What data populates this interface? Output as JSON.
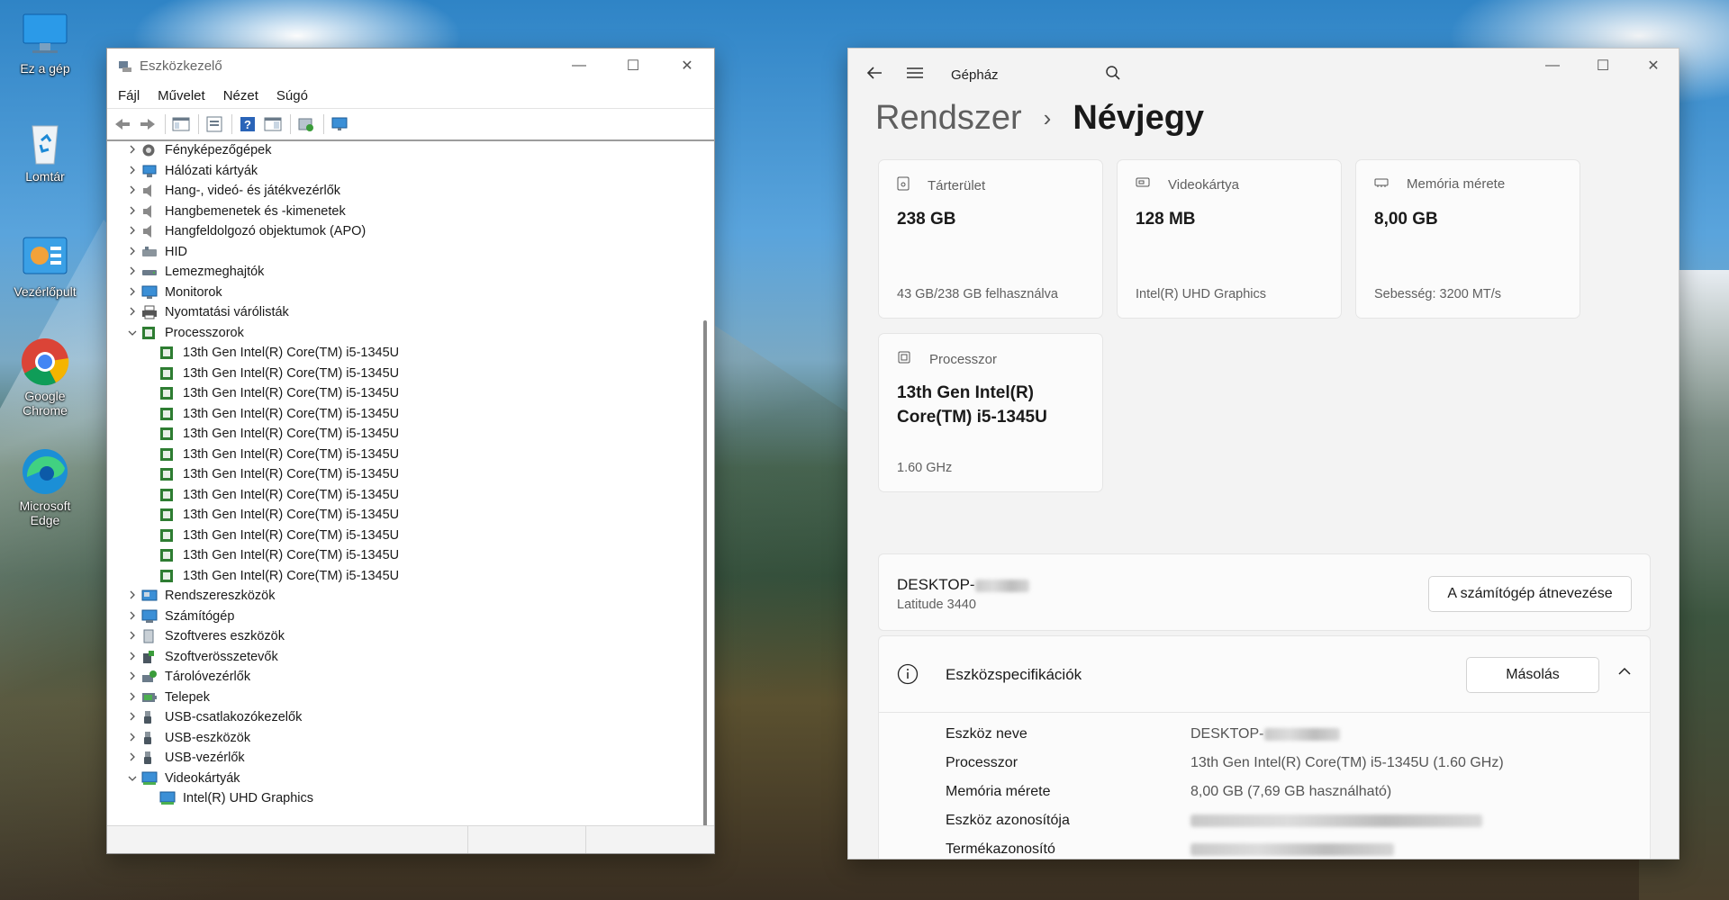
{
  "desktop": {
    "icons": [
      {
        "label": "Ez a gép"
      },
      {
        "label": "Lomtár"
      },
      {
        "label": "Vezérlőpult"
      },
      {
        "label": "Google Chrome"
      },
      {
        "label": "Microsoft Edge"
      }
    ]
  },
  "device_manager": {
    "title": "Eszközkezelő",
    "menu": [
      "Fájl",
      "Művelet",
      "Nézet",
      "Súgó"
    ],
    "tree": [
      {
        "label": "Fényképezőgépek",
        "level": 0,
        "state": "collapsed",
        "icon": "camera-icon"
      },
      {
        "label": "Hálózati kártyák",
        "level": 0,
        "state": "collapsed",
        "icon": "network-adapter-icon"
      },
      {
        "label": "Hang-, videó- és játékvezérlők",
        "level": 0,
        "state": "collapsed",
        "icon": "speaker-icon"
      },
      {
        "label": "Hangbemenetek és -kimenetek",
        "level": 0,
        "state": "collapsed",
        "icon": "speaker-icon"
      },
      {
        "label": "Hangfeldolgozó objektumok (APO)",
        "level": 0,
        "state": "collapsed",
        "icon": "speaker-icon"
      },
      {
        "label": "HID",
        "level": 0,
        "state": "collapsed",
        "icon": "hid-icon"
      },
      {
        "label": "Lemezmeghajtók",
        "level": 0,
        "state": "collapsed",
        "icon": "disk-drive-icon"
      },
      {
        "label": "Monitorok",
        "level": 0,
        "state": "collapsed",
        "icon": "monitor-icon"
      },
      {
        "label": "Nyomtatási várólisták",
        "level": 0,
        "state": "collapsed",
        "icon": "printer-icon"
      },
      {
        "label": "Processzorok",
        "level": 0,
        "state": "expanded",
        "icon": "processor-icon"
      },
      {
        "label": "13th Gen Intel(R) Core(TM) i5-1345U",
        "level": 1,
        "state": "leaf",
        "icon": "processor-icon"
      },
      {
        "label": "13th Gen Intel(R) Core(TM) i5-1345U",
        "level": 1,
        "state": "leaf",
        "icon": "processor-icon"
      },
      {
        "label": "13th Gen Intel(R) Core(TM) i5-1345U",
        "level": 1,
        "state": "leaf",
        "icon": "processor-icon"
      },
      {
        "label": "13th Gen Intel(R) Core(TM) i5-1345U",
        "level": 1,
        "state": "leaf",
        "icon": "processor-icon"
      },
      {
        "label": "13th Gen Intel(R) Core(TM) i5-1345U",
        "level": 1,
        "state": "leaf",
        "icon": "processor-icon"
      },
      {
        "label": "13th Gen Intel(R) Core(TM) i5-1345U",
        "level": 1,
        "state": "leaf",
        "icon": "processor-icon"
      },
      {
        "label": "13th Gen Intel(R) Core(TM) i5-1345U",
        "level": 1,
        "state": "leaf",
        "icon": "processor-icon"
      },
      {
        "label": "13th Gen Intel(R) Core(TM) i5-1345U",
        "level": 1,
        "state": "leaf",
        "icon": "processor-icon"
      },
      {
        "label": "13th Gen Intel(R) Core(TM) i5-1345U",
        "level": 1,
        "state": "leaf",
        "icon": "processor-icon"
      },
      {
        "label": "13th Gen Intel(R) Core(TM) i5-1345U",
        "level": 1,
        "state": "leaf",
        "icon": "processor-icon"
      },
      {
        "label": "13th Gen Intel(R) Core(TM) i5-1345U",
        "level": 1,
        "state": "leaf",
        "icon": "processor-icon"
      },
      {
        "label": "13th Gen Intel(R) Core(TM) i5-1345U",
        "level": 1,
        "state": "leaf",
        "icon": "processor-icon"
      },
      {
        "label": "Rendszereszközök",
        "level": 0,
        "state": "collapsed",
        "icon": "system-devices-icon"
      },
      {
        "label": "Számítógép",
        "level": 0,
        "state": "collapsed",
        "icon": "computer-icon"
      },
      {
        "label": "Szoftveres eszközök",
        "level": 0,
        "state": "collapsed",
        "icon": "software-device-icon"
      },
      {
        "label": "Szoftverösszetevők",
        "level": 0,
        "state": "collapsed",
        "icon": "software-component-icon"
      },
      {
        "label": "Tárolóvezérlők",
        "level": 0,
        "state": "collapsed",
        "icon": "storage-controller-icon"
      },
      {
        "label": "Telepek",
        "level": 0,
        "state": "collapsed",
        "icon": "battery-icon"
      },
      {
        "label": "USB-csatlakozókezelők",
        "level": 0,
        "state": "collapsed",
        "icon": "usb-icon"
      },
      {
        "label": "USB-eszközök",
        "level": 0,
        "state": "collapsed",
        "icon": "usb-icon"
      },
      {
        "label": "USB-vezérlők",
        "level": 0,
        "state": "collapsed",
        "icon": "usb-icon"
      },
      {
        "label": "Videokártyák",
        "level": 0,
        "state": "expanded",
        "icon": "display-adapter-icon"
      },
      {
        "label": "Intel(R) UHD Graphics",
        "level": 1,
        "state": "leaf",
        "icon": "display-adapter-icon"
      }
    ]
  },
  "settings": {
    "app_name": "Gépház",
    "breadcrumb": {
      "parent": "Rendszer",
      "separator": "›",
      "current": "Névjegy"
    },
    "cards": {
      "storage": {
        "label": "Tárterület",
        "value": "238 GB",
        "sub": "43 GB/238 GB felhasználva"
      },
      "gpu": {
        "label": "Videokártya",
        "value": "128 MB",
        "sub": "Intel(R) UHD Graphics"
      },
      "memory": {
        "label": "Memória mérete",
        "value": "8,00 GB",
        "sub": "Sebesség: 3200 MT/s"
      },
      "cpu": {
        "label": "Processzor",
        "value": "13th Gen Intel(R) Core(TM) i5-1345U",
        "sub": "1.60 GHz"
      }
    },
    "device": {
      "name_prefix": "DESKTOP-",
      "model": "Latitude 3440",
      "rename_button": "A számítógép átnevezése"
    },
    "specs": {
      "title": "Eszközspecifikációk",
      "copy_button": "Másolás",
      "rows": [
        {
          "key": "Eszköz neve",
          "value": "DESKTOP-"
        },
        {
          "key": "Processzor",
          "value": "13th Gen Intel(R) Core(TM) i5-1345U (1.60 GHz)"
        },
        {
          "key": "Memória mérete",
          "value": "8,00 GB (7,69 GB használható)"
        },
        {
          "key": "Eszköz azonosítója",
          "value": ""
        },
        {
          "key": "Termékazonosító",
          "value": ""
        }
      ]
    }
  }
}
